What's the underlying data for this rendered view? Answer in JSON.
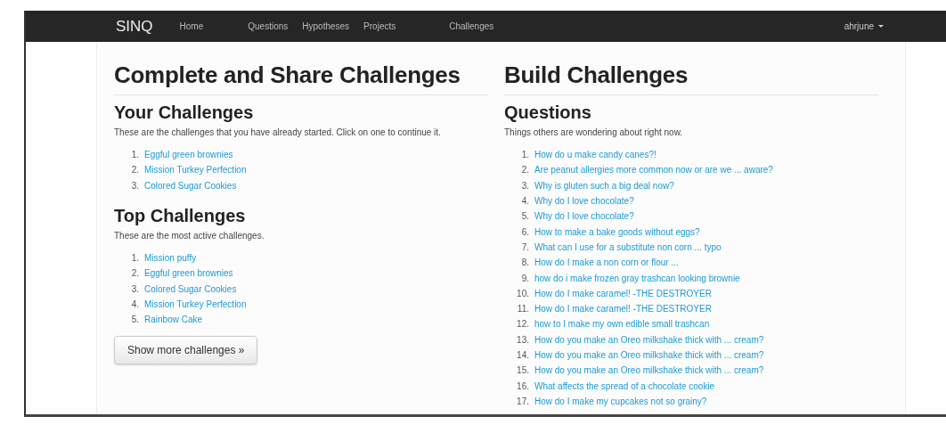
{
  "navbar": {
    "brand": "SINQ",
    "items": [
      "Home",
      "Questions",
      "Hypotheses",
      "Projects",
      "Challenges"
    ],
    "user": "ahrjune"
  },
  "left": {
    "title": "Complete and Share Challenges",
    "sections": [
      {
        "heading": "Your Challenges",
        "description": "These are the challenges that you have already started. Click on one to continue it.",
        "items": [
          {
            "number": "1.",
            "label": "Eggful green brownies"
          },
          {
            "number": "2.",
            "label": "Mission Turkey Perfection"
          },
          {
            "number": "3.",
            "label": "Colored Sugar Cookies"
          }
        ]
      },
      {
        "heading": "Top Challenges",
        "description": "These are the most active challenges.",
        "items": [
          {
            "number": "1.",
            "label": "Mission puffy"
          },
          {
            "number": "2.",
            "label": "Eggful green brownies"
          },
          {
            "number": "3.",
            "label": "Colored Sugar Cookies"
          },
          {
            "number": "4.",
            "label": "Mission Turkey Perfection"
          },
          {
            "number": "5.",
            "label": "Rainbow Cake"
          }
        ]
      }
    ],
    "button": "Show more challenges »"
  },
  "right": {
    "title": "Build Challenges",
    "heading": "Questions",
    "description": "Things others are wondering about right now.",
    "items": [
      {
        "number": "1.",
        "label": "How do u make candy canes?!"
      },
      {
        "number": "2.",
        "label": "Are peanut allergies more common now or are we ... aware?"
      },
      {
        "number": "3.",
        "label": "Why is gluten such a big deal now?"
      },
      {
        "number": "4.",
        "label": "Why do I love chocolate?"
      },
      {
        "number": "5.",
        "label": "Why do I love chocolate?"
      },
      {
        "number": "6.",
        "label": "How to make a bake goods without eggs?"
      },
      {
        "number": "7.",
        "label": "What can I use for a substitute non corn ... typo"
      },
      {
        "number": "8.",
        "label": "How do I make a non corn or flour ..."
      },
      {
        "number": "9.",
        "label": "how do i make frozen gray trashcan looking brownie"
      },
      {
        "number": "10.",
        "label": "How do I make caramel! -THE DESTROYER"
      },
      {
        "number": "11.",
        "label": "How do I make caramel! -THE DESTROYER"
      },
      {
        "number": "12.",
        "label": "how to I make my own edible small trashcan"
      },
      {
        "number": "13.",
        "label": "How do you make an Oreo milkshake thick with ... cream?"
      },
      {
        "number": "14.",
        "label": "How do you make an Oreo milkshake thick with ... cream?"
      },
      {
        "number": "15.",
        "label": "How do you make an Oreo milkshake thick with ... cream?"
      },
      {
        "number": "16.",
        "label": "What affects the spread of a chocolate cookie"
      },
      {
        "number": "17.",
        "label": "How do I make my cupcakes not so grainy?"
      }
    ]
  }
}
